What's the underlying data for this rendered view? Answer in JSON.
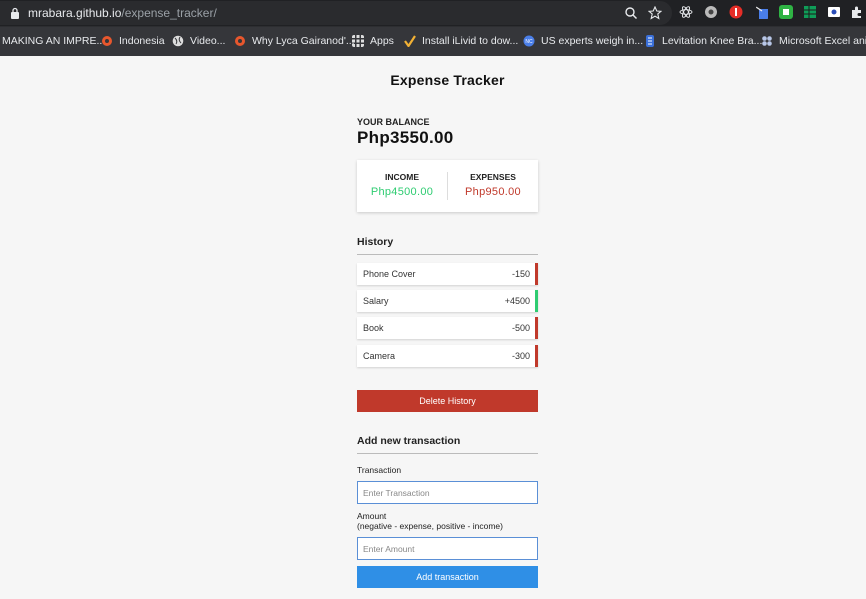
{
  "browser": {
    "url_host": "mrabara.github.io",
    "url_path": "/expense_tracker/",
    "bookmarks": [
      {
        "label": "MAKING AN IMPRE...",
        "icon": "none",
        "color": ""
      },
      {
        "label": "Indonesia",
        "icon": "site-icon",
        "color": "#e8572d"
      },
      {
        "label": "Video...",
        "icon": "globe-icon",
        "color": "#ddd"
      },
      {
        "label": "Why Lyca Gairanod'...",
        "icon": "site-icon",
        "color": "#e8572d"
      },
      {
        "label": "Apps",
        "icon": "apps-grid-icon",
        "color": "#ddd"
      },
      {
        "label": "Install iLivid to dow...",
        "icon": "check-icon",
        "color": "#f2b134"
      },
      {
        "label": "US experts weigh in...",
        "icon": "news-icon",
        "color": "#4a7ee8"
      },
      {
        "label": "Levitation Knee Bra...",
        "icon": "site-icon",
        "color": "#3a6fd8"
      },
      {
        "label": "Microsoft Excel ani...",
        "icon": "flower-icon",
        "color": "#b8c7e8"
      }
    ]
  },
  "app": {
    "title": "Expense Tracker",
    "balance_label": "YOUR BALANCE",
    "balance_value": "Php3550.00",
    "income_label": "INCOME",
    "income_value": "Php4500.00",
    "expense_label": "EXPENSES",
    "expense_value": "Php950.00",
    "history_title": "History",
    "history": [
      {
        "name": "Phone Cover",
        "amount": "-150",
        "type": "expense"
      },
      {
        "name": "Salary",
        "amount": "+4500",
        "type": "income"
      },
      {
        "name": "Book",
        "amount": "-500",
        "type": "expense"
      },
      {
        "name": "Camera",
        "amount": "-300",
        "type": "expense"
      }
    ],
    "delete_button": "Delete History",
    "add_title": "Add new transaction",
    "transaction_label": "Transaction",
    "transaction_placeholder": "Enter Transaction",
    "amount_label": "Amount",
    "amount_hint": "(negative - expense, positive - income)",
    "amount_placeholder": "Enter Amount",
    "add_button": "Add transaction"
  },
  "colors": {
    "income": "#2ecc71",
    "expense": "#c0392b",
    "add_button": "#2f8fe6"
  }
}
